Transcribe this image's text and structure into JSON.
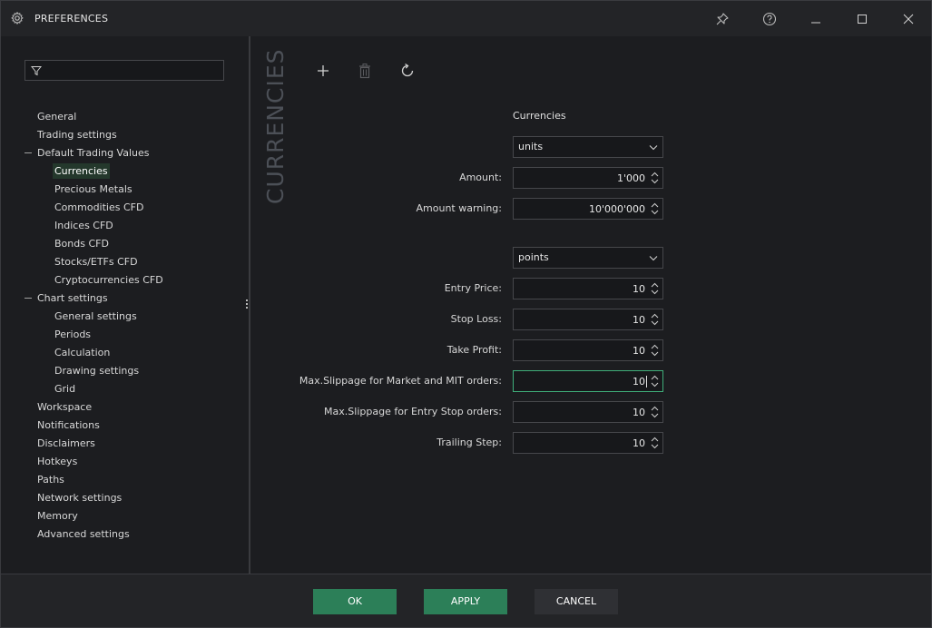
{
  "window": {
    "title": "PREFERENCES"
  },
  "filter": {
    "placeholder": "",
    "value": ""
  },
  "tree": {
    "items": [
      {
        "label": "General",
        "level": 0
      },
      {
        "label": "Trading settings",
        "level": 0
      },
      {
        "label": "Default Trading Values",
        "level": 0,
        "expanded": true
      },
      {
        "label": "Currencies",
        "level": 1,
        "selected": true
      },
      {
        "label": "Precious Metals",
        "level": 1
      },
      {
        "label": "Commodities CFD",
        "level": 1
      },
      {
        "label": "Indices CFD",
        "level": 1
      },
      {
        "label": "Bonds CFD",
        "level": 1
      },
      {
        "label": "Stocks/ETFs CFD",
        "level": 1
      },
      {
        "label": "Cryptocurrencies CFD",
        "level": 1
      },
      {
        "label": "Chart settings",
        "level": 0,
        "expanded": true
      },
      {
        "label": "General settings",
        "level": 1
      },
      {
        "label": "Periods",
        "level": 1
      },
      {
        "label": "Calculation",
        "level": 1
      },
      {
        "label": "Drawing settings",
        "level": 1
      },
      {
        "label": "Grid",
        "level": 1
      },
      {
        "label": "Workspace",
        "level": 0
      },
      {
        "label": "Notifications",
        "level": 0
      },
      {
        "label": "Disclaimers",
        "level": 0
      },
      {
        "label": "Hotkeys",
        "level": 0
      },
      {
        "label": "Paths",
        "level": 0
      },
      {
        "label": "Network settings",
        "level": 0
      },
      {
        "label": "Memory",
        "level": 0
      },
      {
        "label": "Advanced settings",
        "level": 0
      }
    ]
  },
  "panel": {
    "vertical_title": "CURRENCIES",
    "section_label": "Currencies",
    "amount_unit": "units",
    "amount_label": "Amount:",
    "amount_value": "1'000",
    "amount_warning_label": "Amount warning:",
    "amount_warning_value": "10'000'000",
    "price_unit": "points",
    "entry_price_label": "Entry Price:",
    "entry_price_value": "10",
    "stop_loss_label": "Stop Loss:",
    "stop_loss_value": "10",
    "take_profit_label": "Take Profit:",
    "take_profit_value": "10",
    "max_slip_market_label": "Max.Slippage for Market and MIT orders:",
    "max_slip_market_value": "10",
    "max_slip_entry_label": "Max.Slippage for Entry Stop orders:",
    "max_slip_entry_value": "10",
    "trailing_step_label": "Trailing Step:",
    "trailing_step_value": "10"
  },
  "footer": {
    "ok_label": "OK",
    "apply_label": "APPLY",
    "cancel_label": "CANCEL"
  },
  "colors": {
    "accent": "#2c7f58",
    "focus": "#3fae7a",
    "background": "#1c1d20",
    "selected": "#24382c"
  }
}
